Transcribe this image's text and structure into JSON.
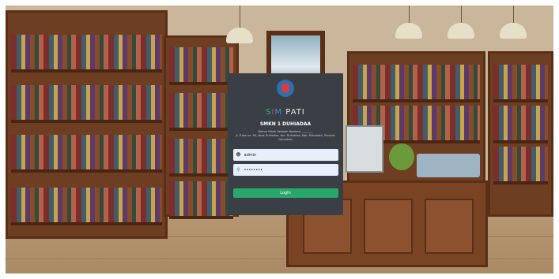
{
  "app": {
    "name_s": "S",
    "name_i": "I",
    "name_m": "M",
    "name_rest": " PATI",
    "school": "SMKN 1 DUHIADAA",
    "npsn_label": "Nomor Pokok Sekolah Nasional",
    "npsn_value": "________",
    "address": "Jl. Trans no. 90, desa Duhiadaa, kec. Duhiadaa, Kab. Pohuwato, Provinsi Gorontalo"
  },
  "form": {
    "username_value": "admin",
    "password_value": "••••••••",
    "username_icon": "user-icon",
    "password_icon": "key-icon",
    "login_label": "Login"
  },
  "colors": {
    "card_bg": "#3a3f45",
    "login_button": "#28a66b",
    "input_bg": "#e8effa"
  }
}
